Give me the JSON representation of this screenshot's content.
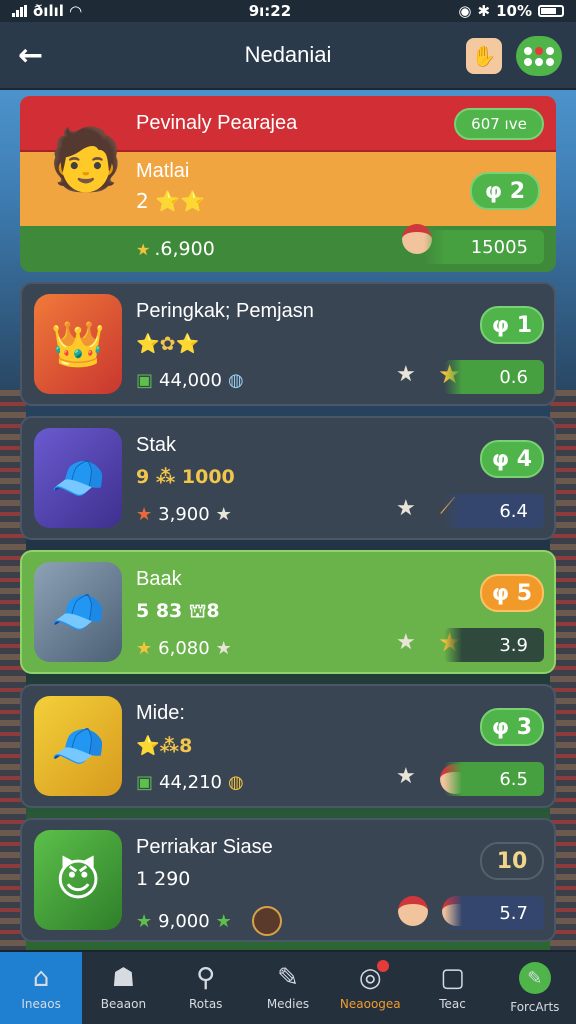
{
  "status": {
    "carrier": "ðılıl",
    "time": "9ı:22",
    "battery": "10%"
  },
  "header": {
    "title": "Nedaniai"
  },
  "top_card": {
    "banner": "Pevinaly Pearajea",
    "banner_pill": "607 ıve",
    "name": "Matlai",
    "rating": "2 ⭐⭐",
    "rank": "φ 2",
    "score": ".6,900",
    "bar_value": "15005"
  },
  "cards": [
    {
      "name": "Peringkak; Pemjasn",
      "rating": "⭐✿⭐",
      "score": "44,000",
      "rank": "φ 1",
      "bar_value": "0.6"
    },
    {
      "name": "Stak",
      "rating": "9 ⁂ 1000",
      "score": "3,900",
      "rank": "φ 4",
      "bar_value": "6.4"
    },
    {
      "name": "Baak",
      "rating": "5 83 ⛫8",
      "score": "6,080",
      "rank": "φ 5",
      "bar_value": "3.9"
    },
    {
      "name": "Mide:",
      "rating": "⭐⁂8",
      "score": "44,210",
      "rank": "φ 3",
      "bar_value": "6.5"
    },
    {
      "name": "Perriakar Siase",
      "rating": "1 290",
      "score": "9,000",
      "rank": "10",
      "bar_value": "5.7"
    }
  ],
  "nav": [
    "Ineaos",
    "Beaaon",
    "Rotas",
    "Medies",
    "Neaoogea",
    "Teac",
    "ForcArts"
  ]
}
